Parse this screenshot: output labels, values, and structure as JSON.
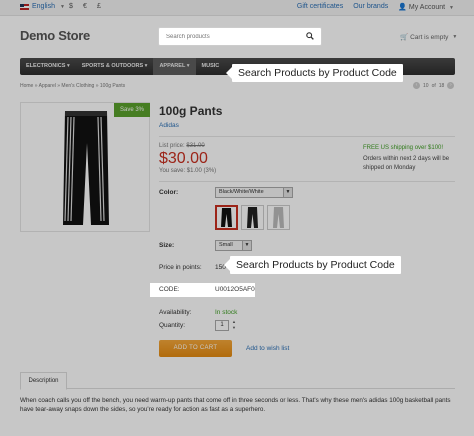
{
  "topbar": {
    "language": "English",
    "currencies": [
      "$",
      "€",
      "£"
    ],
    "links": [
      "Gift certificates",
      "Our brands",
      "My Account"
    ]
  },
  "header": {
    "logo": "Demo Store",
    "search_placeholder": "Search products",
    "cart": "Cart is empty"
  },
  "nav": {
    "items": [
      "ELECTRONICS",
      "SPORTS & OUTDOORS",
      "APPAREL",
      "MUSIC"
    ],
    "active_index": 2
  },
  "callouts": {
    "top": "Search Products by Product Code",
    "middle": "Search Products by Product Code"
  },
  "breadcrumb": "Home  »  Apparel  »  Men's Clothing  »  100g Pants",
  "pager": {
    "current": "10",
    "total": "18"
  },
  "product": {
    "save_badge": "Save 3%",
    "title": "100g Pants",
    "brand": "Adidas",
    "list_price_label": "List price:",
    "list_price": "$31.00",
    "price": "$30.00",
    "you_save": "You save: $1.00 (3%)",
    "shipping": "FREE US shipping over $100!",
    "shipping_note": "Orders within next 2 days will be shipped on Monday",
    "color_label": "Color:",
    "color_value": "Black/White/White",
    "size_label": "Size:",
    "size_value": "Small",
    "points_label": "Price in points:",
    "points_value": "150",
    "code_label": "CODE:",
    "code_value": "U0012O5AF0",
    "availability_label": "Availability:",
    "availability_value": "In stock",
    "quantity_label": "Quantity:",
    "quantity_value": "1",
    "add_to_cart": "ADD TO CART",
    "wishlist": "Add to wish list"
  },
  "tabs": {
    "description": "Description"
  },
  "description": "When coach calls you off the bench, you need warm-up pants that come off in three seconds or less. That's why these men's adidas 100g basketball pants have tear-away snaps down the sides, so you're ready for action as fast as a superhero.",
  "colors": {
    "accent": "#c82f1f",
    "link": "#2a6fb5",
    "green": "#5aa02c",
    "button": "#e48a10"
  }
}
